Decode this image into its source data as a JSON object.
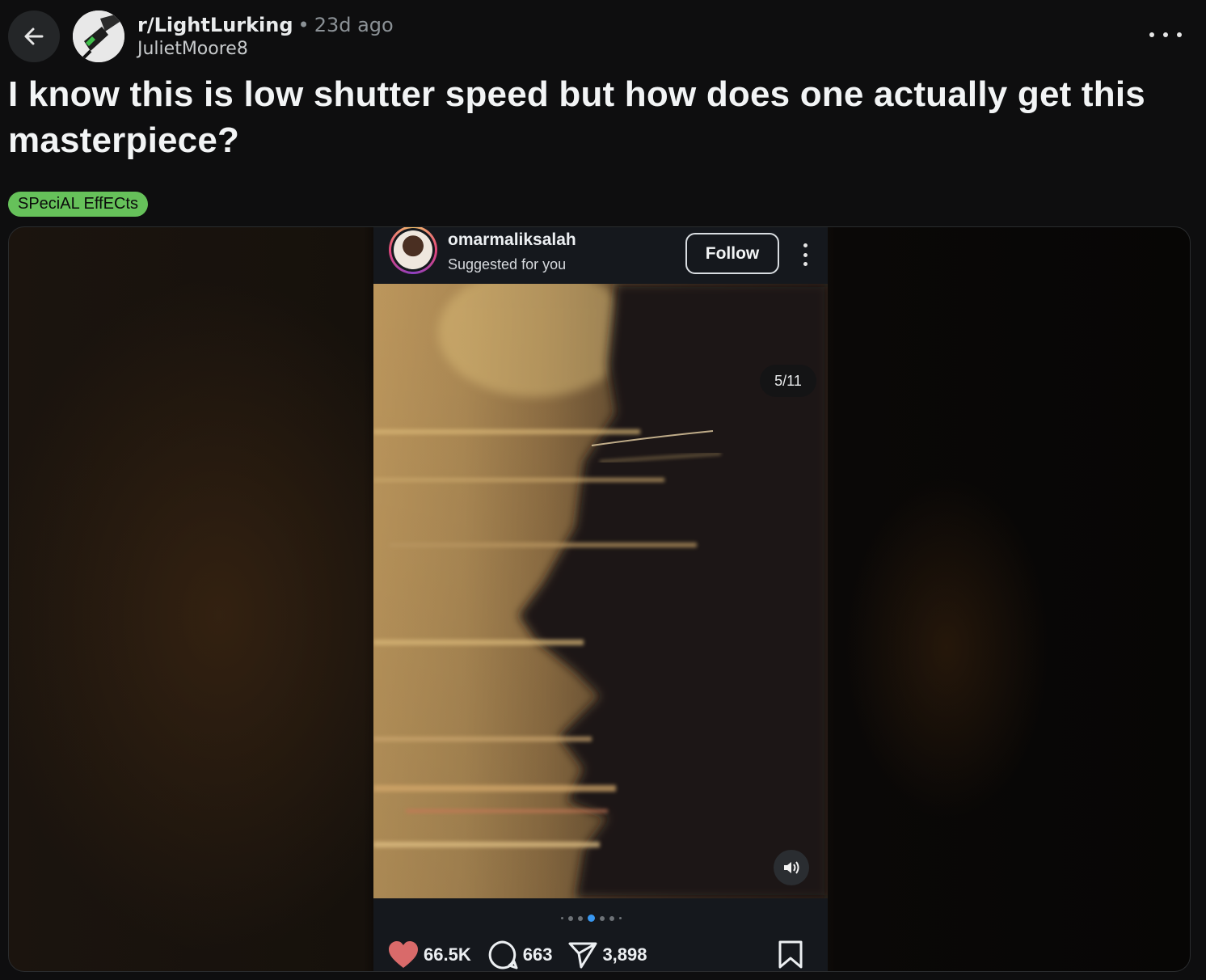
{
  "post": {
    "subreddit": "r/LightLurking",
    "separator": "•",
    "time_ago": "23d ago",
    "author": "JulietMoore8",
    "title": "I know this is low shutter speed but how does one actually get this masterpiece?",
    "flair": "SPeciAL EffECts",
    "flair_color": "#66c15a"
  },
  "instagram": {
    "username": "omarmaliksalah",
    "subtitle": "Suggested for you",
    "follow_label": "Follow",
    "counter": "5/11",
    "carousel_dots": 7,
    "carousel_active_index": 3,
    "likes": "66.5K",
    "comments": "663",
    "shares": "3,898"
  },
  "icons": {
    "back": "arrow-left-icon",
    "more": "ellipsis-icon",
    "sound": "speaker-icon",
    "heart": "heart-icon",
    "comment": "comment-icon",
    "share": "send-icon",
    "bookmark": "bookmark-icon"
  },
  "colors": {
    "background": "#0e0e0f",
    "heart": "#d96a6a",
    "carousel_active": "#3897f0"
  }
}
